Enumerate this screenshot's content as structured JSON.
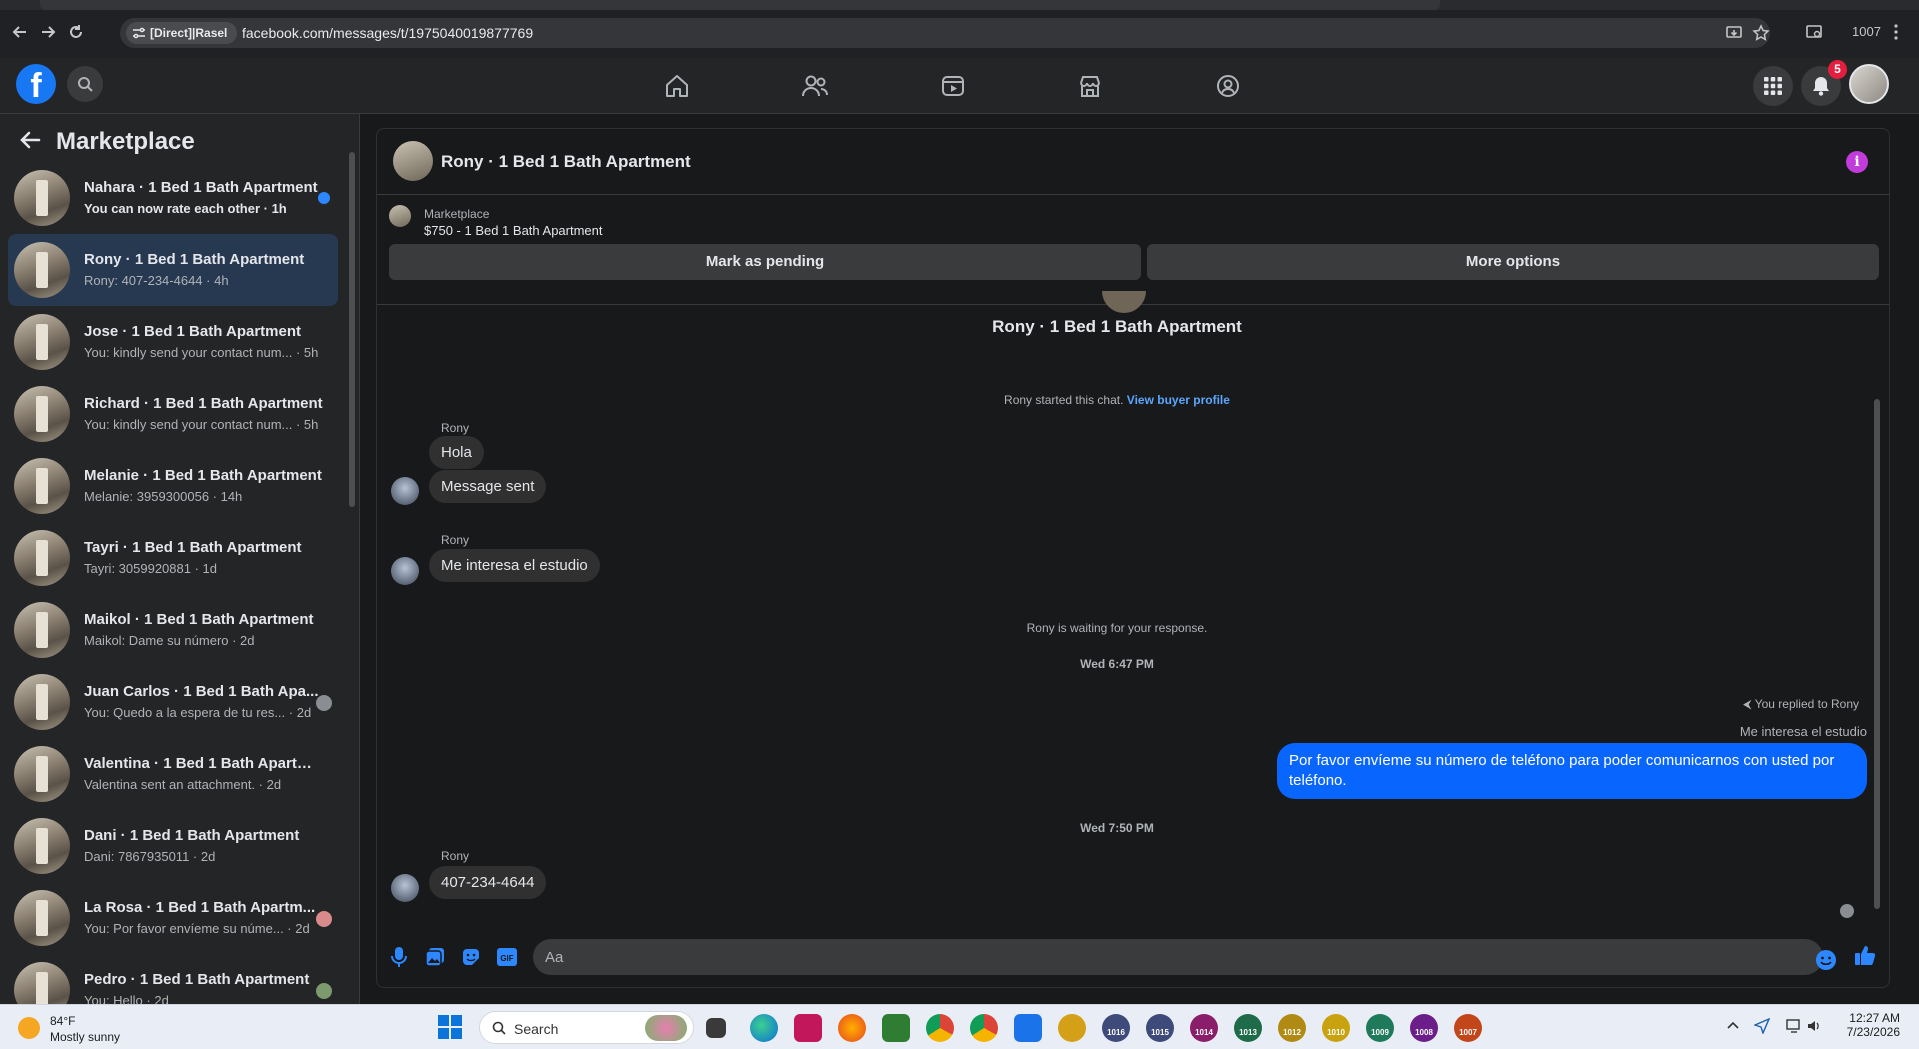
{
  "browser": {
    "site_chip": "[Direct]|Rasel",
    "url": "facebook.com/messages/t/1975040019877769",
    "profile_count": "1007"
  },
  "fb": {
    "notifications_badge": "5"
  },
  "sidebar": {
    "title": "Marketplace",
    "conversations": [
      {
        "name": "Nahara · 1 Bed 1 Bath Apartment",
        "preview": "You can now rate each other · 1h",
        "unread": true
      },
      {
        "name": "Rony · 1 Bed 1 Bath Apartment",
        "preview": "Rony: 407-234-4644 · 4h",
        "active": true
      },
      {
        "name": "Jose · 1 Bed 1 Bath Apartment",
        "preview": "You: kindly send your contact num... · 5h"
      },
      {
        "name": "Richard · 1 Bed 1 Bath Apartment",
        "preview": "You: kindly send your contact num... · 5h"
      },
      {
        "name": "Melanie · 1 Bed 1 Bath Apartment",
        "preview": "Melanie: 3959300056 · 14h"
      },
      {
        "name": "Tayri · 1 Bed 1 Bath Apartment",
        "preview": "Tayri: 3059920881 · 1d"
      },
      {
        "name": "Maikol · 1 Bed 1 Bath Apartment",
        "preview": "Maikol: Dame su número · 2d"
      },
      {
        "name": "Juan Carlos · 1 Bed 1 Bath Apa...",
        "preview": "You: Quedo a la espera de tu res... · 2d",
        "seen": true
      },
      {
        "name": "Valentina · 1 Bed 1 Bath Apartme...",
        "preview": "Valentina sent an attachment. · 2d"
      },
      {
        "name": "Dani · 1 Bed 1 Bath Apartment",
        "preview": "Dani: 7867935011 · 2d"
      },
      {
        "name": "La Rosa · 1 Bed 1 Bath Apartm...",
        "preview": "You: Por favor envíeme su núme... · 2d",
        "seen": true
      },
      {
        "name": "Pedro · 1 Bed 1 Bath Apartment",
        "preview": "You: Hello · 2d",
        "seen": true
      }
    ]
  },
  "chat": {
    "title": "Rony · 1 Bed 1 Bath Apartment",
    "listing_label": "Marketplace",
    "listing_price": "$750 - 1 Bed 1 Bath Apartment",
    "mark_pending": "Mark as pending",
    "more_options": "More options",
    "center_title": "Rony · 1 Bed 1 Bath Apartment",
    "started_text": "Rony started this chat.",
    "view_buyer": "View buyer profile",
    "sender_name": "Rony",
    "msg1": "Hola",
    "msg2": "Message sent",
    "msg3": "Me interesa el estudio",
    "waiting": "Rony is waiting for your response.",
    "ts1": "Wed 6:47 PM",
    "replied_meta": "You replied to Rony",
    "reply_quote": "Me interesa el estudio",
    "out_msg": "Por favor envíeme su número de teléfono para poder comunicarnos con usted por teléfono.",
    "ts2": "Wed 7:50 PM",
    "msg4": "407-234-4644",
    "composer_placeholder": "Aa"
  },
  "taskbar": {
    "temp": "84°F",
    "condition": "Mostly sunny",
    "search": "Search",
    "time": "12:27 AM",
    "date": "7/23/2026",
    "pinned": [
      "1016",
      "1015",
      "1014",
      "1013",
      "1012",
      "1010",
      "1009",
      "1008",
      "1007"
    ]
  },
  "colors": {
    "fb_blue": "#1877f2",
    "outgoing_bubble": "#0866ff",
    "incoming_bubble": "#303030",
    "info_button": "#c13cdb",
    "link": "#5aa7ff",
    "notif_red": "#e41e3f"
  }
}
